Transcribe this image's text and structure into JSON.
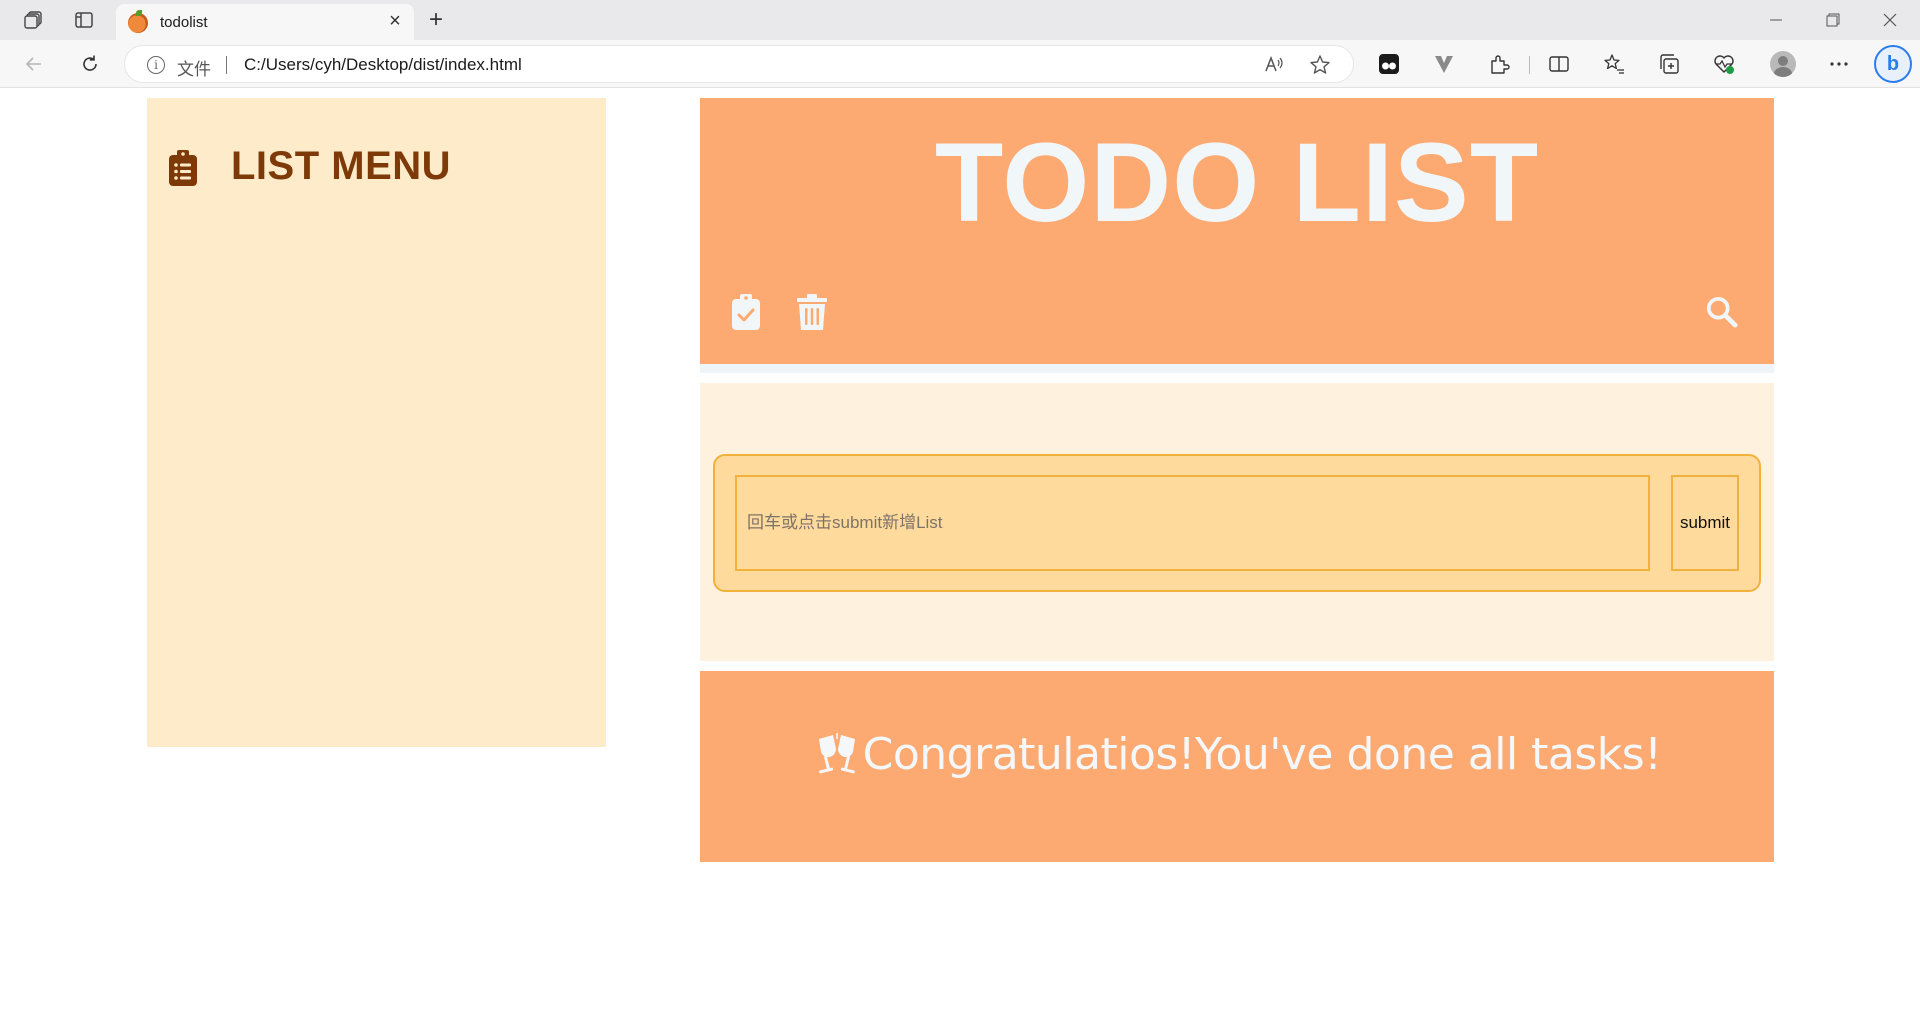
{
  "browser": {
    "tab": {
      "title": "todolist",
      "favicon": "orange-favicon-icon"
    },
    "address_bar": {
      "info_icon": "info-icon",
      "file_label": "文件",
      "url": "C:/Users/cyh/Desktop/dist/index.html"
    },
    "toolbar_icons": [
      "read-aloud-icon",
      "favorite-star-icon",
      "tampermonkey-icon",
      "v-extension-icon",
      "extensions-icon",
      "split-screen-icon",
      "favorites-icon",
      "collections-icon",
      "browser-essentials-icon",
      "profile-avatar",
      "more-icon",
      "bing-copilot-icon"
    ]
  },
  "sidebar": {
    "icon": "clipboard-list-icon",
    "title": "LIST MENU"
  },
  "header": {
    "title": "TODO LIST",
    "actions": [
      "clipboard-check-icon",
      "trash-icon",
      "search-icon"
    ]
  },
  "input_form": {
    "placeholder": "回车或点击submit新增List",
    "value": "",
    "submit_label": "submit"
  },
  "completion": {
    "icon": "champagne-glasses-icon",
    "message": "Congratulatios!You've done all tasks!"
  },
  "colors": {
    "sidebar_bg": "#feebc9",
    "sidebar_title": "#7d3a08",
    "header_bg": "#fdaa72",
    "header_text": "#f1f6f9",
    "input_section_bg": "#fef2df",
    "input_bg": "#ffda9d",
    "input_border": "#f2b13b"
  }
}
